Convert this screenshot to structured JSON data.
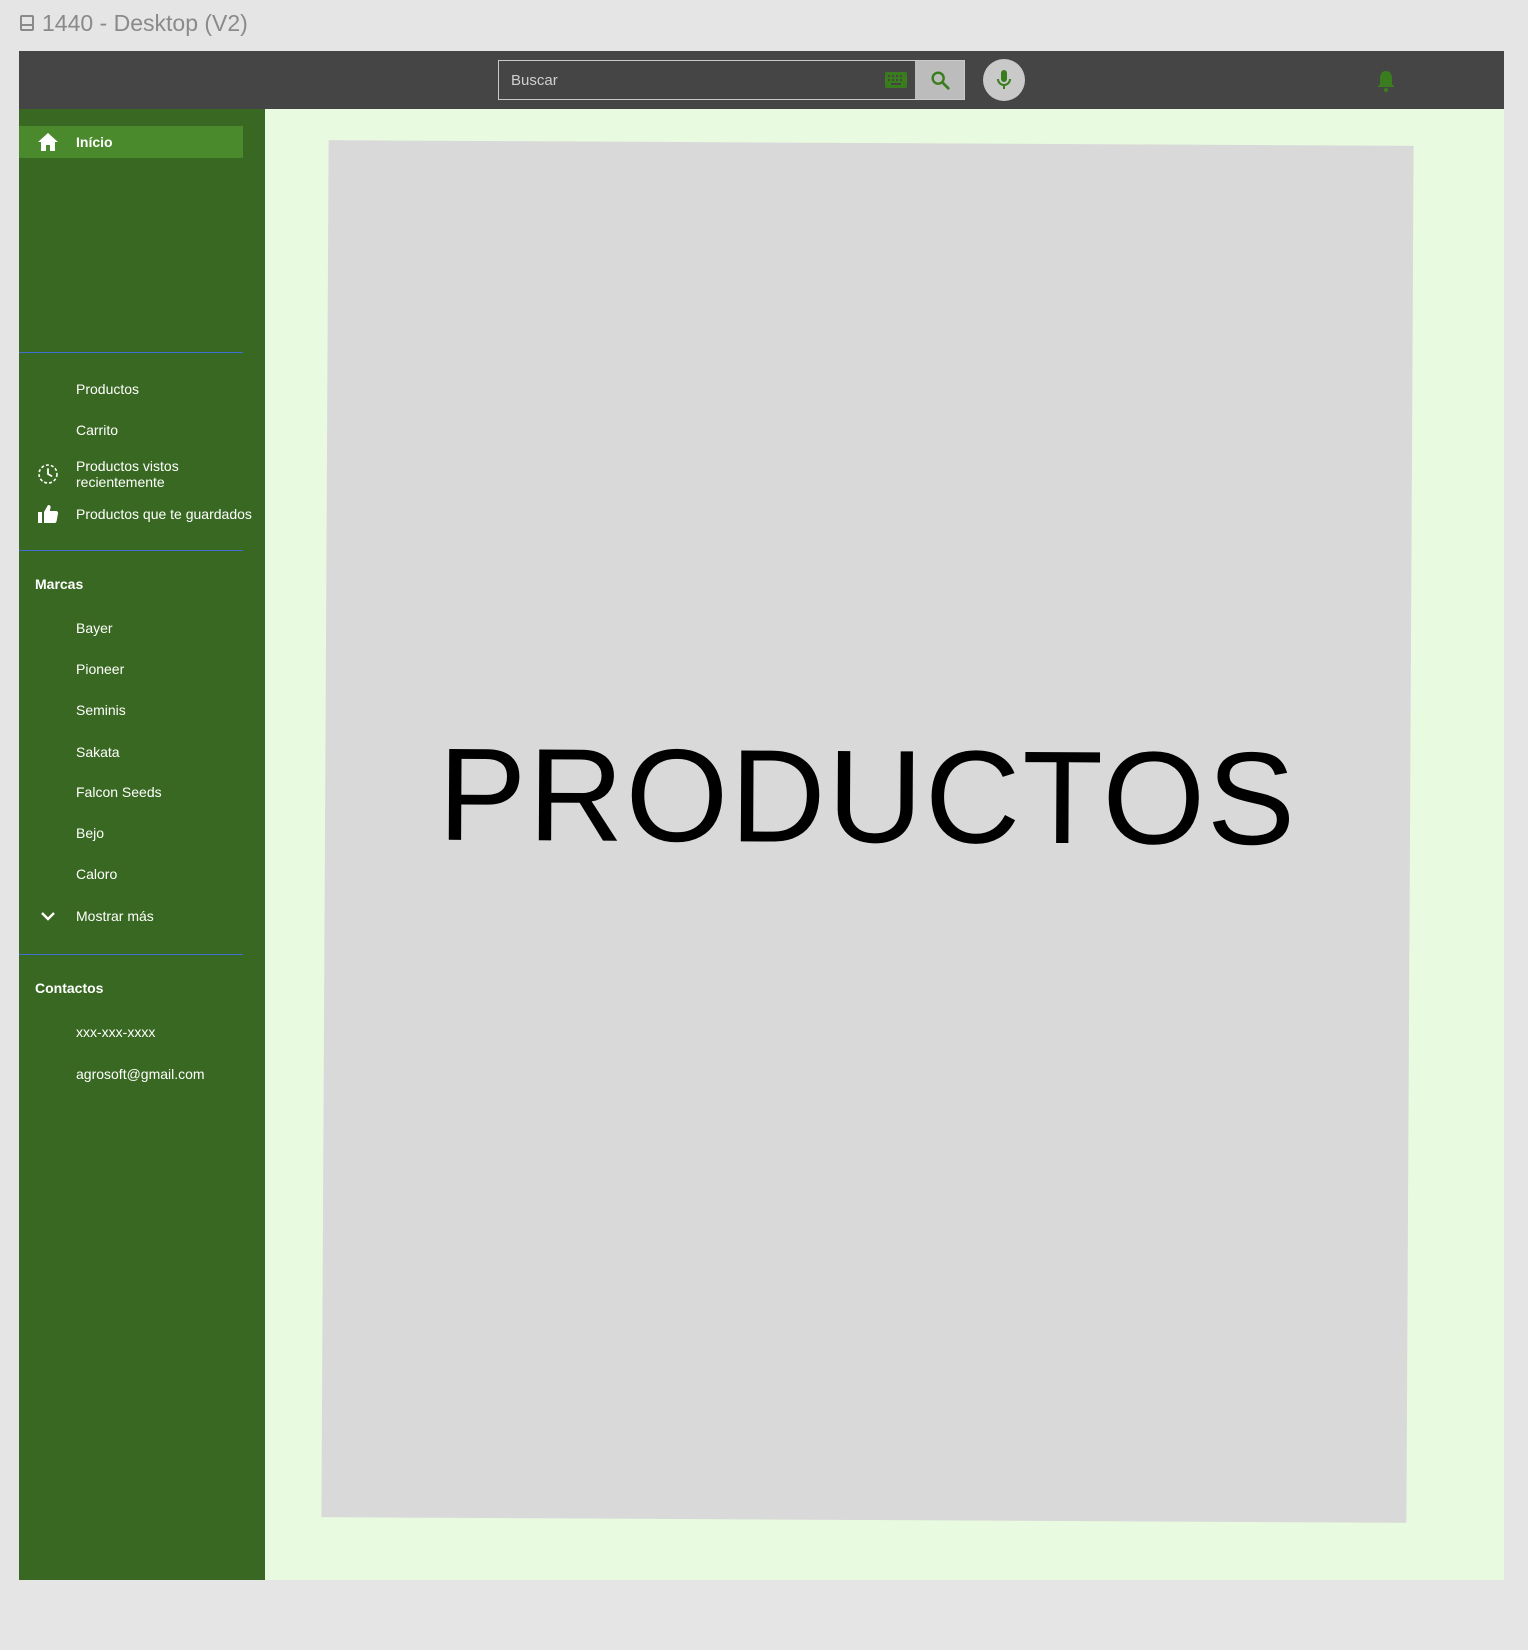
{
  "frame": {
    "label": "1440 - Desktop (V2)"
  },
  "header": {
    "search_placeholder": "Buscar",
    "icons": [
      "keyboard-icon",
      "search-icon",
      "mic-icon",
      "bell-icon"
    ],
    "accent": "#3a7d1e"
  },
  "sidebar": {
    "home": {
      "label": "Início",
      "icon": "home-icon"
    },
    "nav_items": [
      {
        "label": "Productos"
      },
      {
        "label": "Carrito"
      },
      {
        "label": "Productos vistos recientemente",
        "icon": "history-icon"
      },
      {
        "label": "Productos que te guardados",
        "icon": "thumbs-up-icon"
      }
    ],
    "brands_title": "Marcas",
    "brands": [
      "Bayer",
      "Pioneer",
      "Seminis",
      "Sakata",
      "Falcon Seeds",
      "Bejo",
      "Caloro"
    ],
    "show_more": {
      "label": "Mostrar más",
      "icon": "chevron-down-icon"
    },
    "contacts_title": "Contactos",
    "contacts": [
      "xxx-xxx-xxxx",
      "agrosoft@gmail.com"
    ],
    "colors": {
      "background": "#386821",
      "active": "#4a8a2c"
    }
  },
  "main": {
    "title": "PRODUCTOS",
    "background": "#e8fbe0",
    "card_color": "#d9d9d9"
  }
}
